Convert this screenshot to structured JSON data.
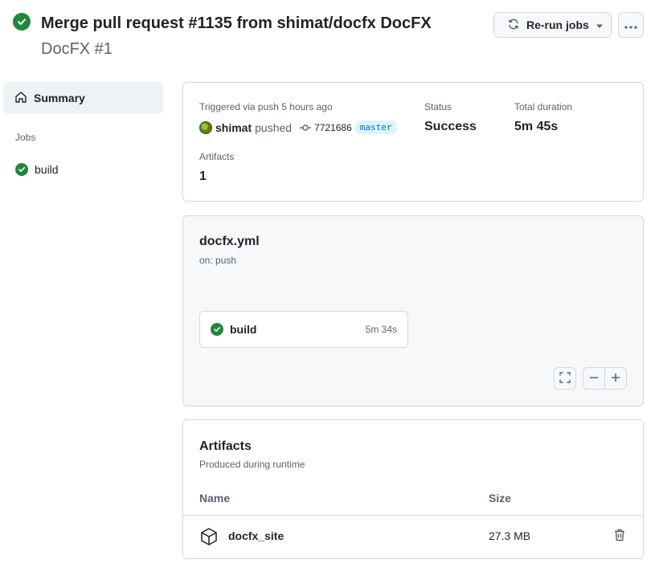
{
  "header": {
    "title": "Merge pull request #1135 from shimat/docfx DocFX",
    "subtitle": "DocFX #1",
    "rerun_label": "Re-run jobs"
  },
  "sidebar": {
    "summary_label": "Summary",
    "jobs_heading": "Jobs",
    "jobs": [
      {
        "label": "build",
        "status": "success"
      }
    ]
  },
  "summary": {
    "trigger_text": "Triggered via push 5 hours ago",
    "actor": "shimat",
    "action": "pushed",
    "commit_sha": "7721686",
    "branch": "master",
    "status_label": "Status",
    "status_value": "Success",
    "duration_label": "Total duration",
    "duration_value": "5m 45s",
    "artifacts_label": "Artifacts",
    "artifacts_count": "1"
  },
  "workflow": {
    "file": "docfx.yml",
    "trigger": "on: push",
    "job": {
      "name": "build",
      "duration": "5m 34s",
      "status": "success"
    }
  },
  "artifacts": {
    "title": "Artifacts",
    "subtitle": "Produced during runtime",
    "columns": {
      "name": "Name",
      "size": "Size"
    },
    "rows": [
      {
        "name": "docfx_site",
        "size": "27.3 MB"
      }
    ]
  },
  "colors": {
    "success": "#1f883d",
    "accent": "#0969da",
    "border": "#d1d9e0",
    "muted_text": "#59636e"
  },
  "icons": [
    "check-circle-icon",
    "sync-icon",
    "triangle-down-icon",
    "kebab-horizontal-icon",
    "home-icon",
    "git-commit-icon",
    "screen-full-icon",
    "dash-icon",
    "plus-icon",
    "package-icon",
    "trash-icon"
  ]
}
